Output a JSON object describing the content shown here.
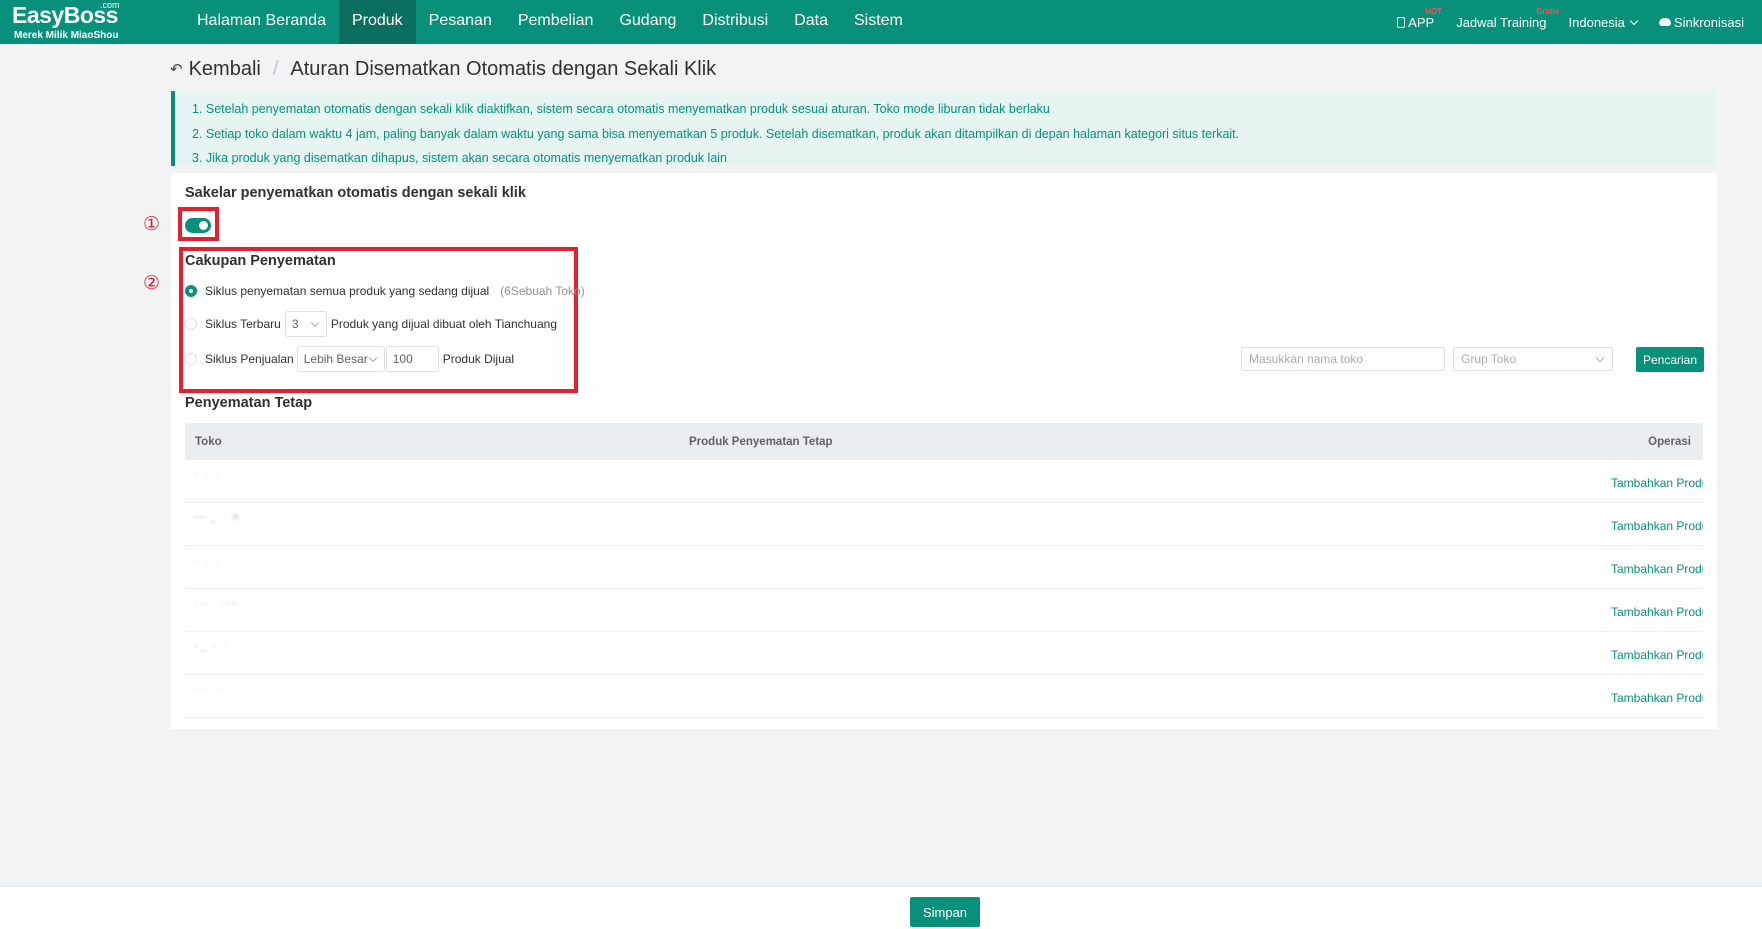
{
  "brand": {
    "name": "EasyBoss",
    "com": ".com",
    "subtitle": "Merek Milik MiaoShou"
  },
  "nav": [
    {
      "label": "Halaman Beranda"
    },
    {
      "label": "Produk"
    },
    {
      "label": "Pesanan"
    },
    {
      "label": "Pembelian"
    },
    {
      "label": "Gudang"
    },
    {
      "label": "Distribusi"
    },
    {
      "label": "Data"
    },
    {
      "label": "Sistem"
    }
  ],
  "header_right": {
    "app_label": "APP",
    "app_badge": "HOT",
    "training_label": "Jadwal Training",
    "training_badge": "Gratis",
    "language": "Indonesia",
    "sync_label": "Sinkronisasi"
  },
  "breadcrumb": {
    "back": "Kembali",
    "title": "Aturan Disematkan Otomatis dengan Sekali Klik"
  },
  "notice": [
    "1. Setelah penyematan otomatis dengan sekali klik diaktifkan, sistem secara otomatis menyematkan produk sesuai aturan. Toko mode liburan tidak berlaku",
    "2. Setiap toko dalam waktu 4 jam, paling banyak dalam waktu yang sama bisa menyematkan 5 produk. Setelah disematkan, produk akan ditampilkan di depan halaman kategori situs terkait.",
    "3. Jika produk yang disematkan dihapus, sistem akan secara otomatis menyematkan produk lain"
  ],
  "switch_section": {
    "title": "Sakelar penyematkan otomatis dengan sekali klik",
    "enabled": true
  },
  "annotations": {
    "one": "①",
    "two": "②"
  },
  "scope": {
    "title": "Cakupan Penyematan",
    "option1": {
      "label": "Siklus penyematan semua produk yang sedang dijual",
      "hint": "(6Sebuah Toko)",
      "selected": true
    },
    "option2": {
      "prefix": "Siklus Terbaru",
      "value": "3",
      "suffix": "Produk yang dijual dibuat oleh Tianchuang",
      "selected": false
    },
    "option3": {
      "prefix": "Siklus Penjualan",
      "compare": "Lebih Besar",
      "value": "100",
      "suffix": "Produk Dijual",
      "selected": false
    }
  },
  "fixed": {
    "title": "Penyematan Tetap",
    "search_placeholder": "Masukkan nama toko",
    "group_placeholder": "Grup Toko",
    "search_button": "Pencarian",
    "columns": {
      "store": "Toko",
      "product": "Produk Penyematan Tetap",
      "operation": "Operasi"
    },
    "rows": [
      {
        "action": "Tambahkan Produk"
      },
      {
        "action": "Tambahkan Produk"
      },
      {
        "action": "Tambahkan Produk"
      },
      {
        "action": "Tambahkan Produk"
      },
      {
        "action": "Tambahkan Produk"
      },
      {
        "action": "Tambahkan Produk"
      }
    ]
  },
  "footer": {
    "save": "Simpan"
  },
  "colors": {
    "primary": "#07917b",
    "annotation_red": "#e5202e",
    "notice_bg": "#e6f5f1"
  }
}
